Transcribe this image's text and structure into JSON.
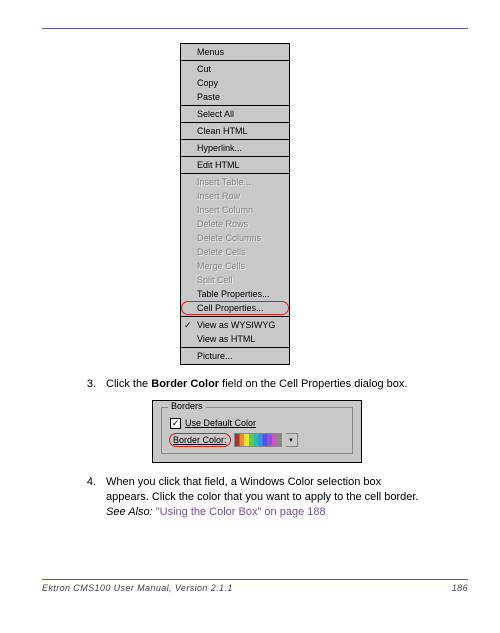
{
  "menu": {
    "groups": [
      [
        {
          "label": "Menus",
          "disabled": false
        }
      ],
      [
        {
          "label": "Cut",
          "disabled": false
        },
        {
          "label": "Copy",
          "disabled": false
        },
        {
          "label": "Paste",
          "disabled": false
        }
      ],
      [
        {
          "label": "Select All",
          "disabled": false
        }
      ],
      [
        {
          "label": "Clean HTML",
          "disabled": false
        }
      ],
      [
        {
          "label": "Hyperlink...",
          "disabled": false
        }
      ],
      [
        {
          "label": "Edit HTML",
          "disabled": false
        }
      ],
      [
        {
          "label": "Insert Table...",
          "disabled": true
        },
        {
          "label": "Insert Row",
          "disabled": true
        },
        {
          "label": "Insert Column",
          "disabled": true
        },
        {
          "label": "Delete Rows",
          "disabled": true
        },
        {
          "label": "Delete Columns",
          "disabled": true
        },
        {
          "label": "Delete Cells",
          "disabled": true
        },
        {
          "label": "Merge Cells",
          "disabled": true
        },
        {
          "label": "Split Cell",
          "disabled": true
        },
        {
          "label": "Table Properties...",
          "disabled": false
        },
        {
          "label": "Cell Properties...",
          "disabled": false,
          "circled": true
        }
      ],
      [
        {
          "label": "View as WYSIWYG",
          "disabled": false,
          "checked": true
        },
        {
          "label": "View as HTML",
          "disabled": false
        }
      ],
      [
        {
          "label": "Picture...",
          "disabled": false
        }
      ]
    ]
  },
  "step3": {
    "num": "3.",
    "pre": "Click the ",
    "bold": "Border Color",
    "post": " field on the Cell Properties dialog box."
  },
  "dialog": {
    "legend": "Borders",
    "checkbox_label": "Use Default Color",
    "checkbox_checked": "✓",
    "color_label": "Border Color:"
  },
  "step4": {
    "num": "4.",
    "text": "When you click that field, a Windows Color selection box appears. Click the color that you want to apply to the cell border.",
    "see_also": "See Also:",
    "link": "\"Using the Color Box\" on page 188"
  },
  "footer": {
    "left": "Ektron CMS100 User Manual, Version 2.1.1",
    "right": "186"
  }
}
